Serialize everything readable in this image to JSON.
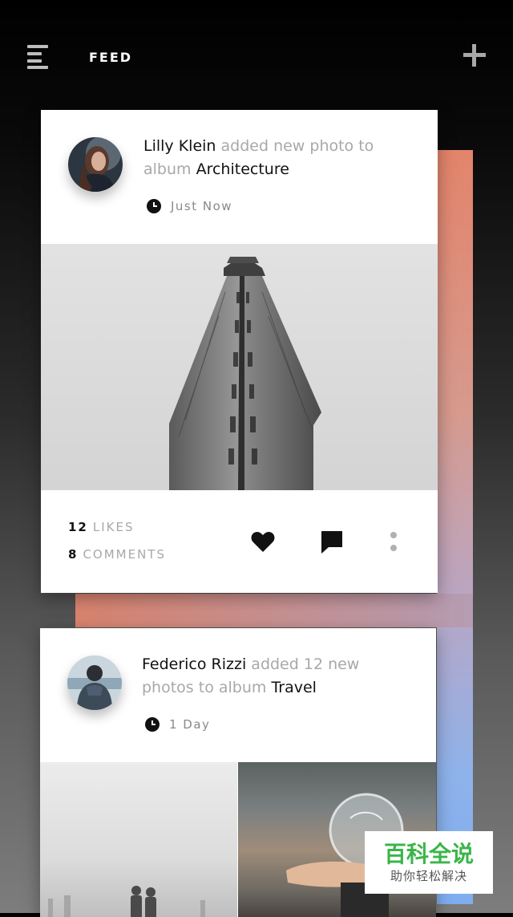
{
  "header": {
    "title": "FEED",
    "menu_icon": "menu-icon",
    "add_icon": "plus-icon"
  },
  "posts": [
    {
      "author": "Lilly Klein",
      "action_text": "added new photo to album",
      "album": "Architecture",
      "time": "Just Now",
      "likes_count": "12",
      "likes_label": "LIKES",
      "comments_count": "8",
      "comments_label": "COMMENTS",
      "actions": [
        "heart-icon",
        "comment-icon",
        "more-icon"
      ]
    },
    {
      "author": "Federico Rizzi",
      "action_text": "added 12 new photos to album",
      "album": "Travel",
      "time": "1 Day"
    }
  ],
  "watermark": {
    "main": "百科全说",
    "sub": "助你轻松解决"
  },
  "colors": {
    "strip_top": "#e3846b",
    "strip_bottom": "#7faef0",
    "watermark_green": "#3bb54a"
  }
}
